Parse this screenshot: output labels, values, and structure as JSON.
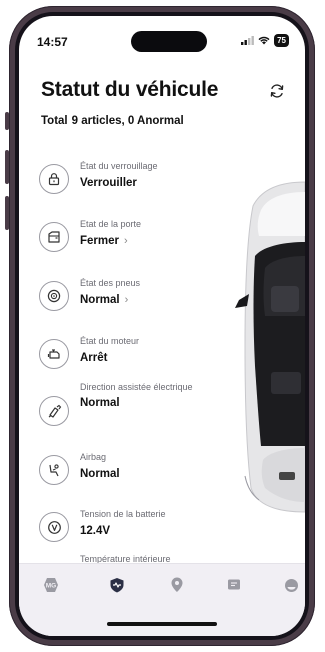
{
  "status_bar": {
    "time": "14:57",
    "battery": "75"
  },
  "header": {
    "title": "Statut du véhicule",
    "refresh_icon": "refresh-icon"
  },
  "summary": {
    "total_label": "Total",
    "total_text": "9 articles, 0 Anormal"
  },
  "items": [
    {
      "icon": "lock-icon",
      "label": "État du verrouillage",
      "value": "Verrouiller",
      "has_chevron": false
    },
    {
      "icon": "door-icon",
      "label": "Etat de la porte",
      "value": "Fermer",
      "has_chevron": true
    },
    {
      "icon": "tire-icon",
      "label": "État des pneus",
      "value": "Normal",
      "has_chevron": true
    },
    {
      "icon": "engine-icon",
      "label": "État du moteur",
      "value": "Arrêt",
      "has_chevron": false
    },
    {
      "icon": "steering-icon",
      "label": "Direction assistée électrique",
      "value": "Normal",
      "has_chevron": false
    },
    {
      "icon": "airbag-icon",
      "label": "Airbag",
      "value": "Normal",
      "has_chevron": false
    },
    {
      "icon": "battery-voltage-icon",
      "label": "Tension de la batterie",
      "value": "12.4V",
      "has_chevron": false
    },
    {
      "icon": "thermometer-icon",
      "label": "Température intérieure",
      "value": "",
      "has_chevron": false
    }
  ],
  "nav": [
    {
      "icon": "mg-logo-icon",
      "active": false
    },
    {
      "icon": "vehicle-health-icon",
      "active": true
    },
    {
      "icon": "location-pin-icon",
      "active": false
    },
    {
      "icon": "message-icon",
      "active": false
    },
    {
      "icon": "profile-icon",
      "active": false
    }
  ],
  "colors": {
    "accent": "#2b2f45",
    "muted": "#9a9aa2",
    "nav_bg": "#f1eff4"
  }
}
